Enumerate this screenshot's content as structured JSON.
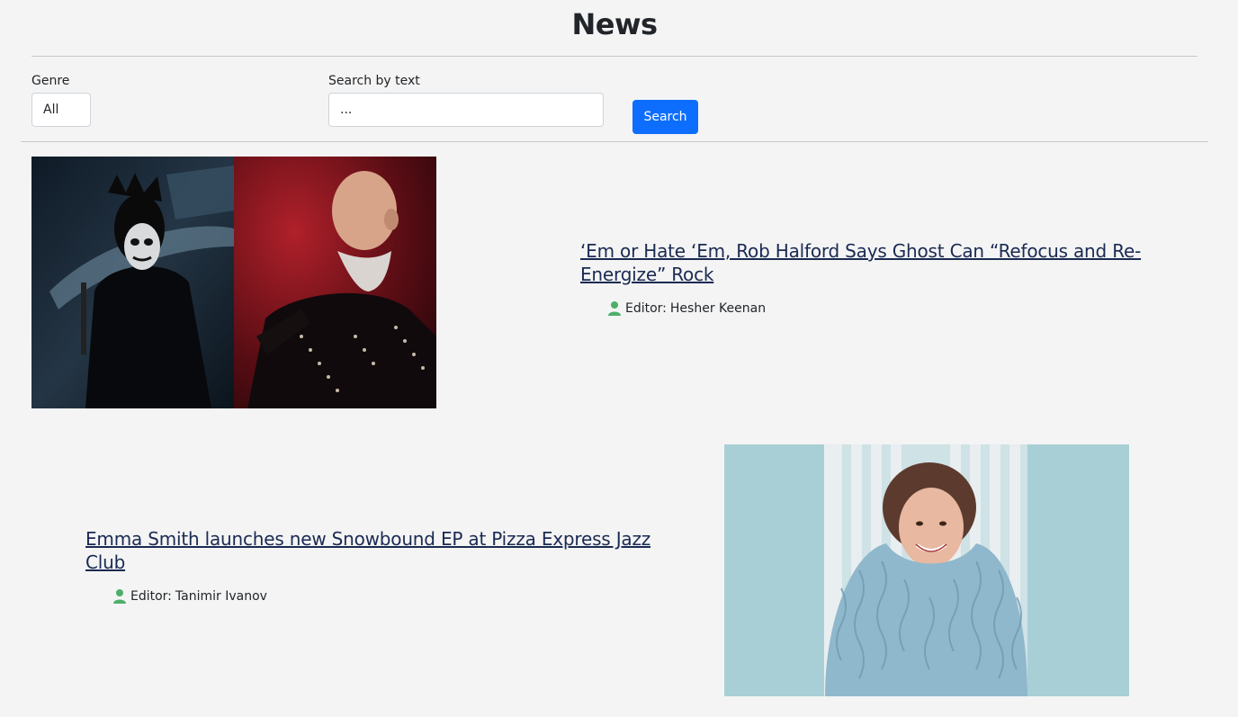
{
  "header": {
    "title": "News"
  },
  "filters": {
    "genre_label": "Genre",
    "genre_selected": "All",
    "search_label": "Search by text",
    "search_placeholder": "...",
    "search_value": "",
    "search_button": "Search"
  },
  "articles": [
    {
      "title": "‘Em or Hate ‘Em, Rob Halford Says Ghost Can “Refocus and Re-Energize” Rock",
      "editor_prefix": "Editor:",
      "editor_name": "Hesher Keenan",
      "image": "ghost-and-rob-halford-photo"
    },
    {
      "title": "Emma Smith launches new Snowbound EP at Pizza Express Jazz Club",
      "editor_prefix": "Editor:",
      "editor_name": "Tanimir Ivanov",
      "image": "emma-smith-photo"
    }
  ],
  "colors": {
    "accent": "#0d6efd",
    "link": "#1a2a52",
    "user_icon": "#4caf6a"
  },
  "icons": {
    "editor": "user-icon"
  }
}
